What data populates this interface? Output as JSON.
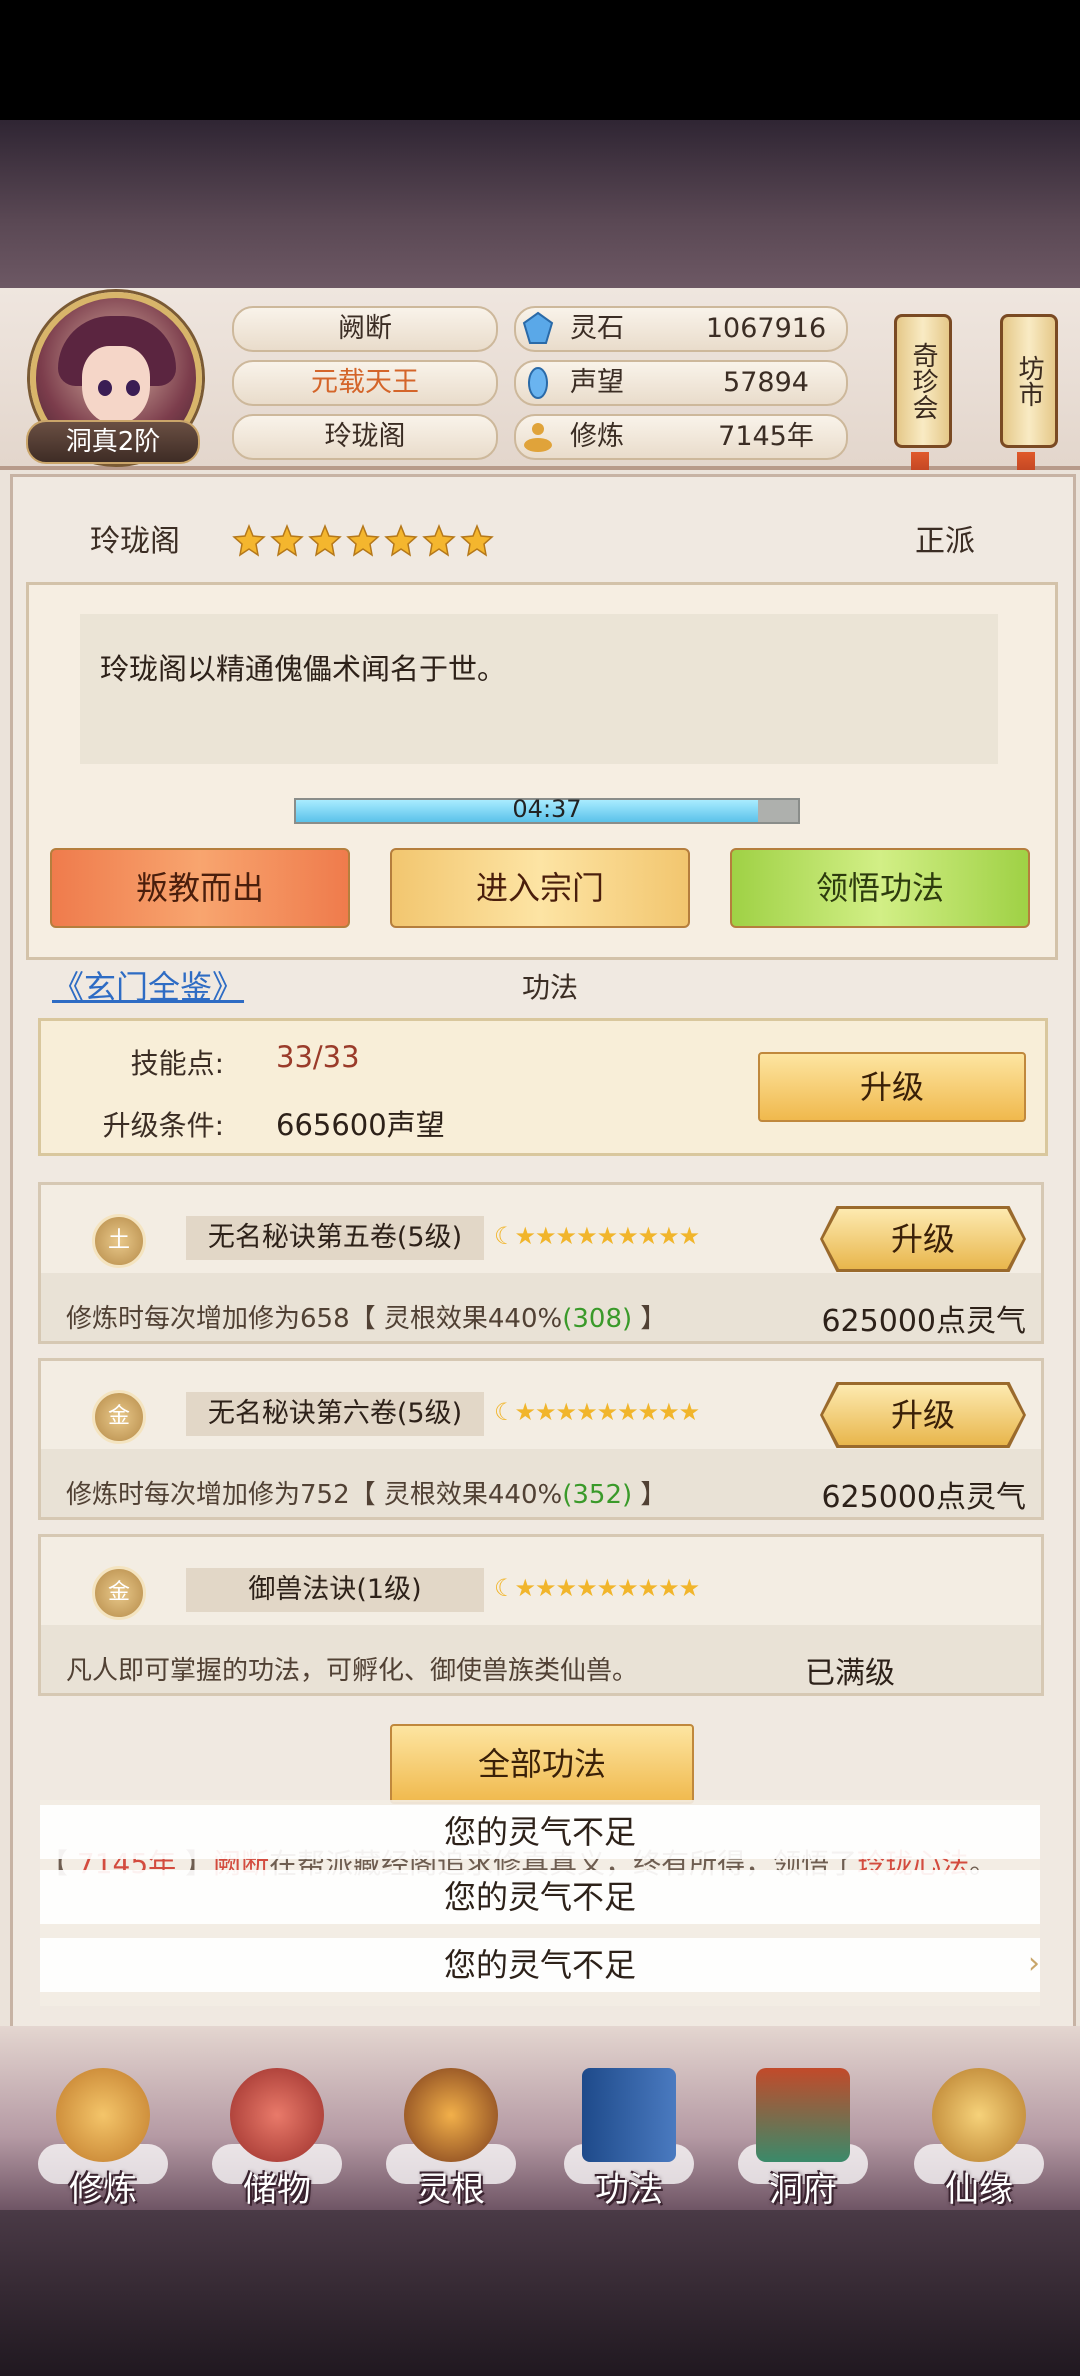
{
  "header": {
    "rank": "洞真2阶",
    "name": "阙断",
    "title": "元载天王",
    "sect": "玲珑阁",
    "resources": [
      {
        "label": "灵石",
        "value": "1067916",
        "icon": "spirit-stone-icon"
      },
      {
        "label": "声望",
        "value": "57894",
        "icon": "reputation-icon"
      },
      {
        "label": "修炼",
        "value": "7145年",
        "icon": "cultivation-icon"
      }
    ],
    "scrolls": [
      "奇珍会",
      "坊市"
    ]
  },
  "sect_panel": {
    "name": "玲珑阁",
    "stars": 7,
    "alignment": "正派",
    "description": "玲珑阁以精通傀儡术闻名于世。",
    "timer": "04:37",
    "timer_progress": 0.92,
    "buttons": {
      "leave": "叛教而出",
      "enter": "进入宗门",
      "learn": "领悟功法"
    }
  },
  "gongfa": {
    "link": "《玄门全鉴》",
    "title": "功法",
    "skill_points_label": "技能点:",
    "skill_points": "33/33",
    "upgrade_cond_label": "升级条件:",
    "upgrade_cond": "665600声望",
    "upgrade_button": "升级",
    "techniques": [
      {
        "element": "土",
        "name": "无名秘诀第五卷(5级)",
        "stars": "☾★★★★★★★★★",
        "desc_prefix": "修炼时每次增加修为658【 灵根效果440%",
        "desc_bonus": "(308)",
        "desc_suffix": " 】",
        "cost": "625000点灵气",
        "button": "升级"
      },
      {
        "element": "金",
        "name": "无名秘诀第六卷(5级)",
        "stars": "☾★★★★★★★★★",
        "desc_prefix": "修炼时每次增加修为752【 灵根效果440%",
        "desc_bonus": "(352)",
        "desc_suffix": " 】",
        "cost": "625000点灵气",
        "button": "升级"
      },
      {
        "element": "金",
        "name": "御兽法诀(1级)",
        "stars": "☾★★★★★★★★★",
        "desc_prefix": "凡人即可掌握的功法，可孵化、御使兽族类仙兽。",
        "desc_bonus": "",
        "desc_suffix": "",
        "cost": "已满级",
        "button": ""
      }
    ],
    "all_button": "全部功法"
  },
  "log": {
    "year": "7145年",
    "name": "阙断",
    "text_mid": "在帮派藏经阁追求修真真义，终有所得，领悟了",
    "skill": "玲珑心法",
    "end": "。"
  },
  "toasts": [
    "您的灵气不足",
    "您的灵气不足",
    "您的灵气不足"
  ],
  "nav": [
    {
      "label": "修炼",
      "icon": "cultivate-icon"
    },
    {
      "label": "储物",
      "icon": "storage-bag-icon"
    },
    {
      "label": "灵根",
      "icon": "spirit-root-icon"
    },
    {
      "label": "功法",
      "icon": "technique-book-icon"
    },
    {
      "label": "洞府",
      "icon": "cave-dwelling-icon"
    },
    {
      "label": "仙缘",
      "icon": "immortal-fate-icon"
    }
  ],
  "colors": {
    "accent_gold": "#f0b94d",
    "link_blue": "#2e6cc4",
    "bonus_green": "#3a9a2a",
    "highlight_red": "#d34b3e"
  }
}
